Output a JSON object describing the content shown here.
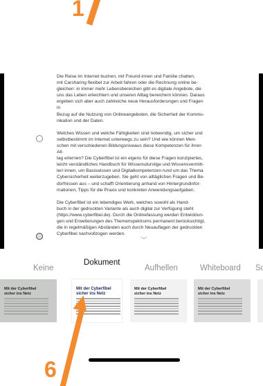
{
  "annotations": {
    "step_top": "1",
    "step_bottom": "6",
    "accent": "#f28a30"
  },
  "document": {
    "paragraphs": [
      "Die Reise im Internet buchen, mit Freund-innen und Familie chatten,\nmit Carsharing flexibel zur Arbeit fahren oder die Rechnung online be-\ngleichen: in immer mehr Lebensbereichen gibt es digitale Angebote, die\nuns das Leben erleichtern und unseren Alltag bereichern können. Daraus\nergeben sich aber auch zahlreiche neue Herausforderungen und Fragen in\nBezug auf die Nutzung von Onlineangeboten, die Sicherheit der Kommu-\nnikation und der Daten.",
      "Welches Wissen und welche Fähigkeiten sind notwendig, um sicher und\nselbstbestimmt im Internet unterwegs zu sein? Und wie können Men-\nschen mit verschiedenen Bildungsniveaus diese Kompetenzen für ihren All-\ntag erlernen? Die Cyberfibel ist ein eigens für diese Fragen konzipiertes,\nleicht verständliches Handbuch für Wissensdurstige und Wissensvermitt-\nler/-innen, um Basiswissen und Digitalkompetenzen rund um das Thema\nCybersicherheit weiterzugeben. Sie geht von alltäglichen Fragen und Be-\ndürfnissen aus – und schafft Orientierung anhand von Hintergrundinfor-\nmationen, Tipps für die Praxis und konkreten Anwendungsaufgaben.",
      "Die Cyberfibel ist ein lebendiges Werk, welches sowohl als Hand-\nbuch in der gedruckten Variante als auch digital zur Verfügung steht\n(https://www.cyberfibel.de). Durch die Onlinefassung werden Entwicklun-\ngen und Erweiterungen des Themenspektrums permanent berücksichtigt,\ndie in regelmäßigen Abständen auch durch Neuauflagen der gedruckten\nCyberfibel nachvollzogen werden."
    ],
    "chevron_icon": "chevron-down-icon"
  },
  "filters": {
    "selected": "Dokument",
    "items": [
      {
        "label": "Keine"
      },
      {
        "label": "Dokument"
      },
      {
        "label": "Aufhellen"
      },
      {
        "label": "Whiteboard"
      },
      {
        "label": "Sc"
      }
    ],
    "thumb_title": "Mit der Cyberfibel\nsicher ins Netz"
  }
}
